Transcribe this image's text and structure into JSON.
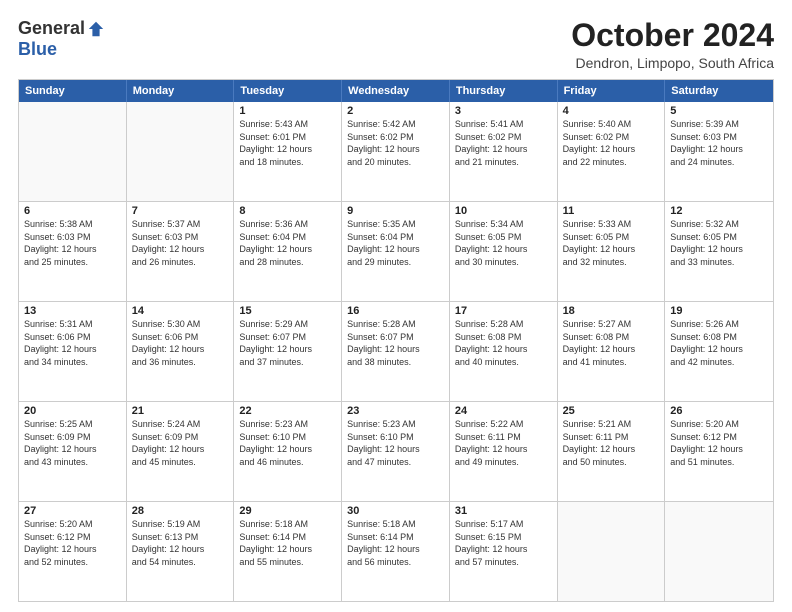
{
  "logo": {
    "general": "General",
    "blue": "Blue"
  },
  "title": "October 2024",
  "subtitle": "Dendron, Limpopo, South Africa",
  "header_days": [
    "Sunday",
    "Monday",
    "Tuesday",
    "Wednesday",
    "Thursday",
    "Friday",
    "Saturday"
  ],
  "weeks": [
    [
      {
        "day": "",
        "info": "",
        "empty": true
      },
      {
        "day": "",
        "info": "",
        "empty": true
      },
      {
        "day": "1",
        "info": "Sunrise: 5:43 AM\nSunset: 6:01 PM\nDaylight: 12 hours\nand 18 minutes."
      },
      {
        "day": "2",
        "info": "Sunrise: 5:42 AM\nSunset: 6:02 PM\nDaylight: 12 hours\nand 20 minutes."
      },
      {
        "day": "3",
        "info": "Sunrise: 5:41 AM\nSunset: 6:02 PM\nDaylight: 12 hours\nand 21 minutes."
      },
      {
        "day": "4",
        "info": "Sunrise: 5:40 AM\nSunset: 6:02 PM\nDaylight: 12 hours\nand 22 minutes."
      },
      {
        "day": "5",
        "info": "Sunrise: 5:39 AM\nSunset: 6:03 PM\nDaylight: 12 hours\nand 24 minutes."
      }
    ],
    [
      {
        "day": "6",
        "info": "Sunrise: 5:38 AM\nSunset: 6:03 PM\nDaylight: 12 hours\nand 25 minutes."
      },
      {
        "day": "7",
        "info": "Sunrise: 5:37 AM\nSunset: 6:03 PM\nDaylight: 12 hours\nand 26 minutes."
      },
      {
        "day": "8",
        "info": "Sunrise: 5:36 AM\nSunset: 6:04 PM\nDaylight: 12 hours\nand 28 minutes."
      },
      {
        "day": "9",
        "info": "Sunrise: 5:35 AM\nSunset: 6:04 PM\nDaylight: 12 hours\nand 29 minutes."
      },
      {
        "day": "10",
        "info": "Sunrise: 5:34 AM\nSunset: 6:05 PM\nDaylight: 12 hours\nand 30 minutes."
      },
      {
        "day": "11",
        "info": "Sunrise: 5:33 AM\nSunset: 6:05 PM\nDaylight: 12 hours\nand 32 minutes."
      },
      {
        "day": "12",
        "info": "Sunrise: 5:32 AM\nSunset: 6:05 PM\nDaylight: 12 hours\nand 33 minutes."
      }
    ],
    [
      {
        "day": "13",
        "info": "Sunrise: 5:31 AM\nSunset: 6:06 PM\nDaylight: 12 hours\nand 34 minutes."
      },
      {
        "day": "14",
        "info": "Sunrise: 5:30 AM\nSunset: 6:06 PM\nDaylight: 12 hours\nand 36 minutes."
      },
      {
        "day": "15",
        "info": "Sunrise: 5:29 AM\nSunset: 6:07 PM\nDaylight: 12 hours\nand 37 minutes."
      },
      {
        "day": "16",
        "info": "Sunrise: 5:28 AM\nSunset: 6:07 PM\nDaylight: 12 hours\nand 38 minutes."
      },
      {
        "day": "17",
        "info": "Sunrise: 5:28 AM\nSunset: 6:08 PM\nDaylight: 12 hours\nand 40 minutes."
      },
      {
        "day": "18",
        "info": "Sunrise: 5:27 AM\nSunset: 6:08 PM\nDaylight: 12 hours\nand 41 minutes."
      },
      {
        "day": "19",
        "info": "Sunrise: 5:26 AM\nSunset: 6:08 PM\nDaylight: 12 hours\nand 42 minutes."
      }
    ],
    [
      {
        "day": "20",
        "info": "Sunrise: 5:25 AM\nSunset: 6:09 PM\nDaylight: 12 hours\nand 43 minutes."
      },
      {
        "day": "21",
        "info": "Sunrise: 5:24 AM\nSunset: 6:09 PM\nDaylight: 12 hours\nand 45 minutes."
      },
      {
        "day": "22",
        "info": "Sunrise: 5:23 AM\nSunset: 6:10 PM\nDaylight: 12 hours\nand 46 minutes."
      },
      {
        "day": "23",
        "info": "Sunrise: 5:23 AM\nSunset: 6:10 PM\nDaylight: 12 hours\nand 47 minutes."
      },
      {
        "day": "24",
        "info": "Sunrise: 5:22 AM\nSunset: 6:11 PM\nDaylight: 12 hours\nand 49 minutes."
      },
      {
        "day": "25",
        "info": "Sunrise: 5:21 AM\nSunset: 6:11 PM\nDaylight: 12 hours\nand 50 minutes."
      },
      {
        "day": "26",
        "info": "Sunrise: 5:20 AM\nSunset: 6:12 PM\nDaylight: 12 hours\nand 51 minutes."
      }
    ],
    [
      {
        "day": "27",
        "info": "Sunrise: 5:20 AM\nSunset: 6:12 PM\nDaylight: 12 hours\nand 52 minutes."
      },
      {
        "day": "28",
        "info": "Sunrise: 5:19 AM\nSunset: 6:13 PM\nDaylight: 12 hours\nand 54 minutes."
      },
      {
        "day": "29",
        "info": "Sunrise: 5:18 AM\nSunset: 6:14 PM\nDaylight: 12 hours\nand 55 minutes."
      },
      {
        "day": "30",
        "info": "Sunrise: 5:18 AM\nSunset: 6:14 PM\nDaylight: 12 hours\nand 56 minutes."
      },
      {
        "day": "31",
        "info": "Sunrise: 5:17 AM\nSunset: 6:15 PM\nDaylight: 12 hours\nand 57 minutes."
      },
      {
        "day": "",
        "info": "",
        "empty": true
      },
      {
        "day": "",
        "info": "",
        "empty": true
      }
    ]
  ]
}
